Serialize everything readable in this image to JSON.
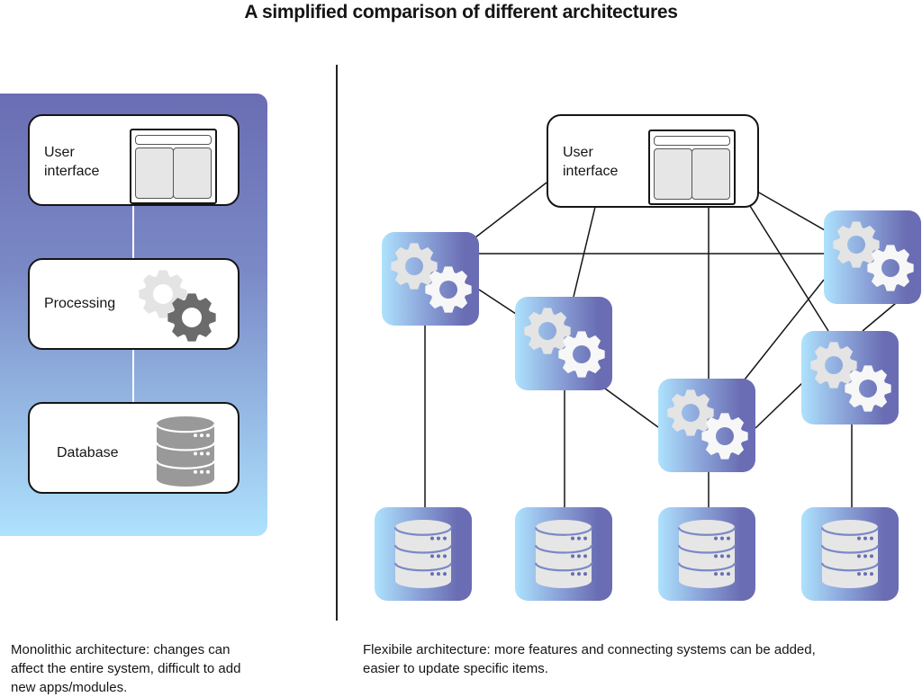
{
  "title": "A simplified comparison of different architectures",
  "colors": {
    "gradient_dark": "#6a6db3",
    "gradient_light": "#aee2fd",
    "icon_gray": "#999999",
    "text": "#151515"
  },
  "monolithic": {
    "layers": [
      {
        "label_line1": "User",
        "label_line2": "interface",
        "icon": "ui-window-icon"
      },
      {
        "label": "Processing",
        "icon": "gears-icon"
      },
      {
        "label": "Database",
        "icon": "database-icon"
      }
    ],
    "caption": [
      "Monolithic architecture: changes can",
      "affect the entire system, difficult to add",
      "new apps/modules."
    ]
  },
  "flexible": {
    "ui_node": {
      "label_line1": "User",
      "label_line2": "interface",
      "icon": "ui-window-icon"
    },
    "processing_nodes": [
      {
        "id": "A",
        "icon": "gears-icon"
      },
      {
        "id": "B",
        "icon": "gears-icon"
      },
      {
        "id": "C",
        "icon": "gears-icon"
      },
      {
        "id": "D",
        "icon": "gears-icon"
      },
      {
        "id": "E",
        "icon": "gears-icon"
      }
    ],
    "database_nodes": [
      {
        "id": "DB1",
        "connected_to": "A",
        "icon": "database-icon"
      },
      {
        "id": "DB2",
        "connected_to": "B",
        "icon": "database-icon"
      },
      {
        "id": "DB3",
        "connected_to": "C",
        "icon": "database-icon"
      },
      {
        "id": "DB4",
        "connected_to": "D",
        "icon": "database-icon"
      }
    ],
    "connections": [
      [
        "UI",
        "A"
      ],
      [
        "UI",
        "B"
      ],
      [
        "UI",
        "C"
      ],
      [
        "UI",
        "D"
      ],
      [
        "UI",
        "E"
      ],
      [
        "A",
        "E"
      ],
      [
        "A",
        "B"
      ],
      [
        "B",
        "C"
      ],
      [
        "C",
        "E"
      ],
      [
        "C",
        "D"
      ],
      [
        "E",
        "D"
      ],
      [
        "A",
        "DB1"
      ],
      [
        "B",
        "DB2"
      ],
      [
        "C",
        "DB3"
      ],
      [
        "D",
        "DB4"
      ]
    ],
    "caption": [
      "Flexibile architecture: more features and connecting systems can be added,",
      "easier to update specific items."
    ]
  }
}
